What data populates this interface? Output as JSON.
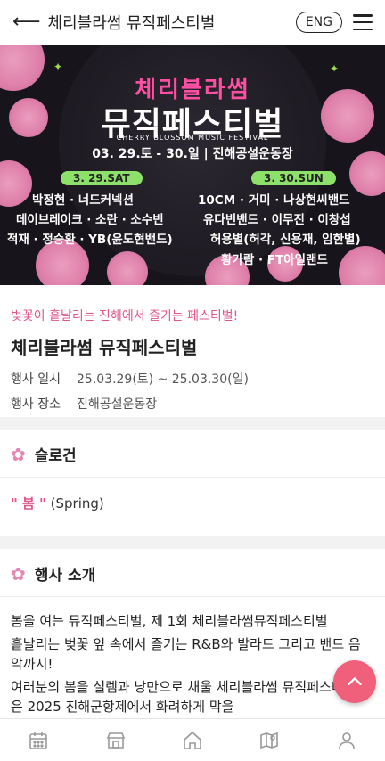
{
  "header": {
    "back_icon": "arrow-left-icon",
    "title": "체리블라썸 뮤직페스티벌",
    "lang_button": "ENG",
    "menu_icon": "hamburger-icon"
  },
  "poster": {
    "logo_top": "체리블라썸",
    "logo_main": "뮤직페스티벌",
    "subtitle": "CHERRY BLOSSOM MUSIC FESTIVAL",
    "dates": "03. 29.토 - 30.일 | 진해공설운동장",
    "day1_label": "3. 29.SAT",
    "day2_label": "3. 30.SUN",
    "day1_lines": [
      "박정현 · 너드커넥션",
      "데이브레이크 · 소란 · 소수빈",
      "적재 · 정승환 · YB(윤도현밴드)"
    ],
    "day2_lines": [
      "10CM · 거미 · 나상현씨밴드",
      "유다빈밴드 · 이무진 · 이창섭",
      "허용별(허각, 신용재, 임한별)",
      "황가람 · FT아일랜드"
    ]
  },
  "event": {
    "tagline": "벚꽃이 흩날리는 진해에서 즐기는 페스티벌!",
    "name": "체리블라썸 뮤직페스티벌",
    "date_label": "행사 일시",
    "date_value": "25.03.29(토) ~ 25.03.30(일)",
    "place_label": "행사 장소",
    "place_value": "진해공설운동장"
  },
  "slogan_section": {
    "title": "슬로건",
    "quote_open": "\" 봄 \"",
    "text": "(Spring)"
  },
  "intro_section": {
    "title": "행사 소개",
    "paragraphs": [
      "봄을 여는 뮤직페스티벌, 제 1회 체리블라썸뮤직페스티벌",
      "흩날리는 벚꽃 잎 속에서 즐기는 R&B와 발라드 그리고 밴드 음악까지!",
      "여러분의 봄을 설렘과 낭만으로 채울 체리블라썸 뮤직페스티벌은 2025 진해군항제에서 화려하게 막을"
    ]
  },
  "tabbar": {
    "items": [
      "calendar-icon",
      "store-icon",
      "home-icon",
      "map-icon",
      "user-icon"
    ]
  },
  "colors": {
    "accent_pink": "#e0558a",
    "fab": "#f0607a",
    "poster_bg": "#17141b"
  }
}
